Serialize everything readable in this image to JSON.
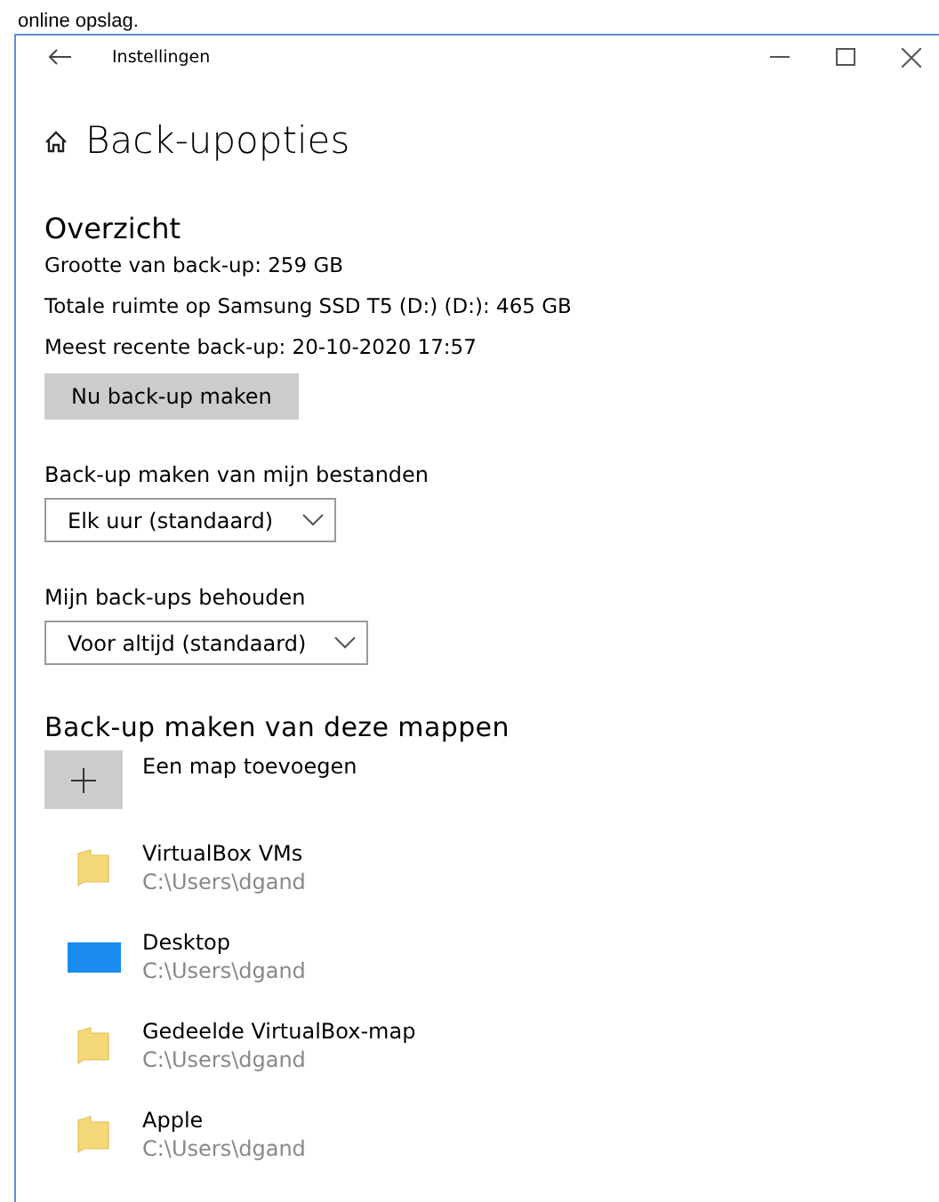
{
  "caption": "online opslag.",
  "window": {
    "title": "Instellingen"
  },
  "page": {
    "title": "Back-upopties"
  },
  "overview": {
    "heading": "Overzicht",
    "lines": [
      "Grootte van back-up: 259 GB",
      "Totale ruimte op Samsung SSD T5 (D:) (D:): 465 GB",
      "Meest recente back-up: 20-10-2020 17:57"
    ],
    "button": "Nu back-up maken"
  },
  "settings": [
    {
      "label": "Back-up maken van mijn bestanden",
      "value": "Elk uur (standaard)"
    },
    {
      "label": "Mijn back-ups behouden",
      "value": "Voor altijd (standaard)"
    }
  ],
  "folders": {
    "heading": "Back-up maken van deze mappen",
    "add_label": "Een map toevoegen",
    "items": [
      {
        "kind": "folder",
        "name": "VirtualBox VMs",
        "path": "C:\\Users\\dgand"
      },
      {
        "kind": "desktop",
        "name": "Desktop",
        "path": "C:\\Users\\dgand"
      },
      {
        "kind": "folder",
        "name": "Gedeelde VirtualBox-map",
        "path": "C:\\Users\\dgand"
      },
      {
        "kind": "folder",
        "name": "Apple",
        "path": "C:\\Users\\dgand"
      }
    ]
  }
}
